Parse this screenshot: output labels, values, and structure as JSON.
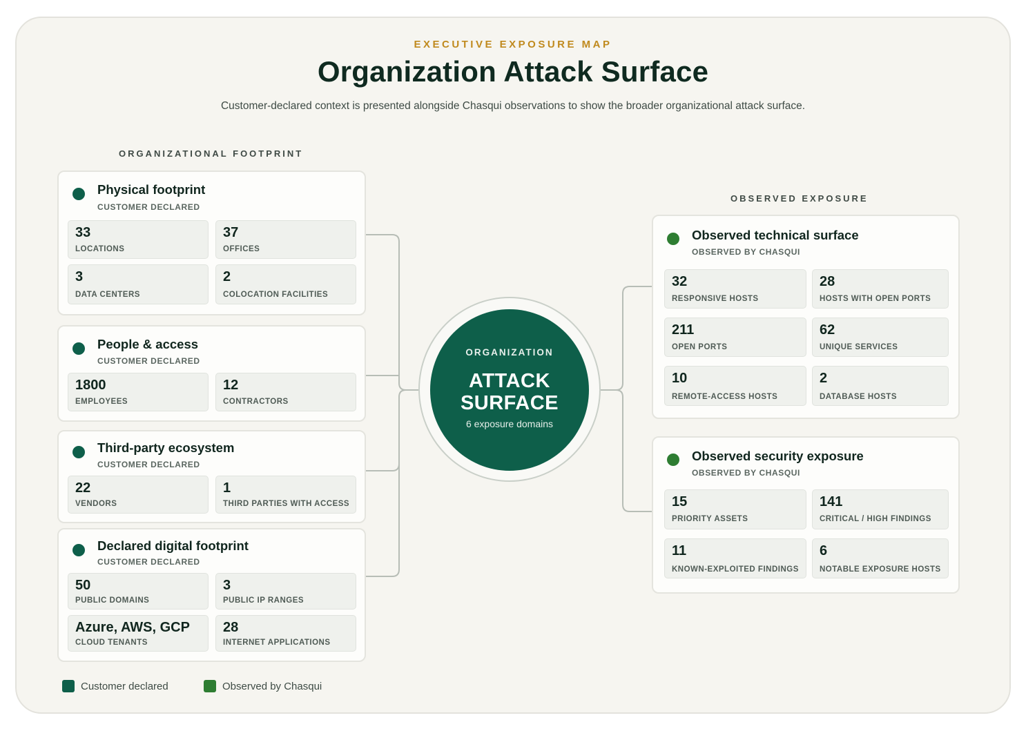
{
  "header": {
    "eyebrow": "EXECUTIVE EXPOSURE MAP",
    "title": "Organization Attack Surface",
    "subtitle": "Customer-declared context is presented alongside Chasqui observations to show the broader organizational attack surface."
  },
  "sections": {
    "left": "ORGANIZATIONAL FOOTPRINT",
    "right": "OBSERVED EXPOSURE"
  },
  "colors": {
    "customer_declared": "#0e5f4a",
    "observed": "#2e7d32",
    "accent": "#c08a1e"
  },
  "hub": {
    "eyebrow": "ORGANIZATION",
    "line1": "ATTACK",
    "line2": "SURFACE",
    "note": "6 exposure domains"
  },
  "groups": {
    "physical": {
      "title": "Physical footprint",
      "subtitle": "CUSTOMER DECLARED",
      "stats": [
        {
          "value": "33",
          "label": "LOCATIONS"
        },
        {
          "value": "37",
          "label": "OFFICES"
        },
        {
          "value": "3",
          "label": "DATA CENTERS"
        },
        {
          "value": "2",
          "label": "COLOCATION FACILITIES"
        }
      ]
    },
    "people": {
      "title": "People & access",
      "subtitle": "CUSTOMER DECLARED",
      "stats": [
        {
          "value": "1800",
          "label": "EMPLOYEES"
        },
        {
          "value": "12",
          "label": "CONTRACTORS"
        }
      ]
    },
    "thirdparty": {
      "title": "Third-party ecosystem",
      "subtitle": "CUSTOMER DECLARED",
      "stats": [
        {
          "value": "22",
          "label": "VENDORS"
        },
        {
          "value": "1",
          "label": "THIRD PARTIES WITH ACCESS"
        }
      ]
    },
    "digital": {
      "title": "Declared digital footprint",
      "subtitle": "CUSTOMER DECLARED",
      "stats": [
        {
          "value": "50",
          "label": "PUBLIC DOMAINS"
        },
        {
          "value": "3",
          "label": "PUBLIC IP RANGES"
        },
        {
          "value": "Azure, AWS, GCP",
          "label": "CLOUD TENANTS"
        },
        {
          "value": "28",
          "label": "INTERNET APPLICATIONS"
        }
      ]
    },
    "technical": {
      "title": "Observed technical surface",
      "subtitle": "OBSERVED BY CHASQUI",
      "stats": [
        {
          "value": "32",
          "label": "RESPONSIVE HOSTS"
        },
        {
          "value": "28",
          "label": "HOSTS WITH OPEN PORTS"
        },
        {
          "value": "211",
          "label": "OPEN PORTS"
        },
        {
          "value": "62",
          "label": "UNIQUE SERVICES"
        },
        {
          "value": "10",
          "label": "REMOTE-ACCESS HOSTS"
        },
        {
          "value": "2",
          "label": "DATABASE HOSTS"
        }
      ]
    },
    "security": {
      "title": "Observed security exposure",
      "subtitle": "OBSERVED BY CHASQUI",
      "stats": [
        {
          "value": "15",
          "label": "PRIORITY ASSETS"
        },
        {
          "value": "141",
          "label": "CRITICAL / HIGH FINDINGS"
        },
        {
          "value": "11",
          "label": "KNOWN-EXPLOITED FINDINGS"
        },
        {
          "value": "6",
          "label": "NOTABLE EXPOSURE HOSTS"
        }
      ]
    }
  },
  "legend": {
    "customer": "Customer declared",
    "observed": "Observed by Chasqui"
  }
}
